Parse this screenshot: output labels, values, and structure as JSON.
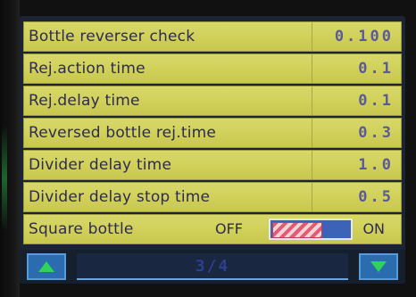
{
  "params": [
    {
      "label": "Bottle reverser check",
      "value": "0.100"
    },
    {
      "label": "Rej.action time",
      "value": "0.1"
    },
    {
      "label": "Rej.delay time",
      "value": "0.1"
    },
    {
      "label": "Reversed bottle rej.time",
      "value": "0.3"
    },
    {
      "label": "Divider delay time",
      "value": "1.0"
    },
    {
      "label": "Divider delay stop time",
      "value": "0.5"
    }
  ],
  "toggle": {
    "label": "Square bottle",
    "off_label": "OFF",
    "on_label": "ON",
    "state": "OFF"
  },
  "pager": {
    "page": "3/4"
  },
  "colors": {
    "row_background": "#d3d35f",
    "label_text": "#2e2a54",
    "value_text": "#5a5a9a",
    "toggle_track": "#3c63b8",
    "toggle_knob": "#e35a72",
    "nav_arrow": "#2fd35a",
    "nav_button": "#2a6cae"
  },
  "icons": {
    "prev": "up-arrow-icon",
    "next": "down-arrow-icon"
  }
}
